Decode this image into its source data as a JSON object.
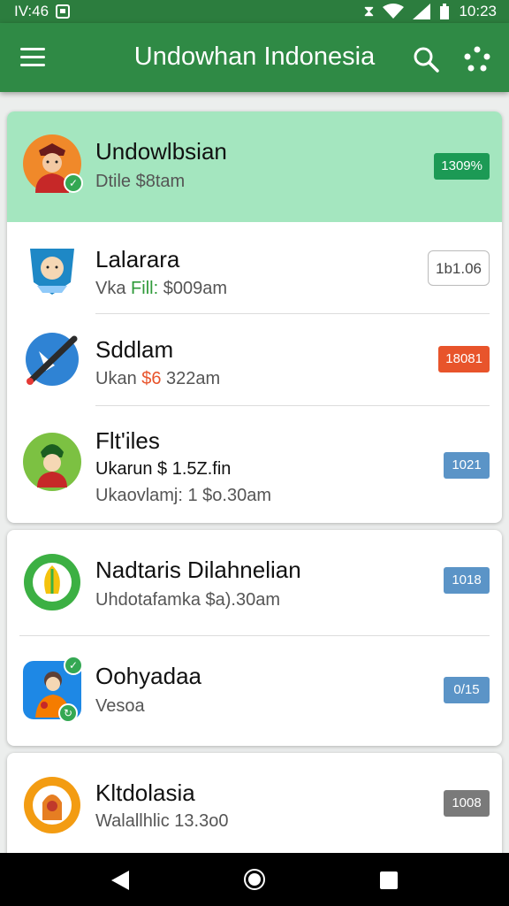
{
  "status_bar": {
    "left_time": "IV:46",
    "right_time": "10:23"
  },
  "app_bar": {
    "title": "Undowhan Indonesia"
  },
  "items": [
    {
      "name": "Undowlbsian",
      "sub": "Dtile $8tam",
      "badge": "1309%",
      "badge_color": "#1c9a55"
    },
    {
      "name": "Lalarara",
      "sub_prefix": "Vka ",
      "sub_highlight": "Fill:",
      "sub_suffix": " $009am",
      "badge": "1b1.06",
      "badge_prefix": "#"
    },
    {
      "name": "Sddlam",
      "sub_prefix": "Ukan ",
      "sub_highlight": "$6",
      "sub_suffix": " 322am",
      "badge": "18081",
      "badge_color": "#e8542b"
    },
    {
      "name": "Flt'iles",
      "sub": "Ukarun $ 1.5Z.fin",
      "sub2": "Ukaovlamj: 1 $o.30am",
      "badge": "1021",
      "badge_color": "#5b94c7"
    },
    {
      "name": "Nadtaris Dilahnelian",
      "sub": "Uhdotafamka $a).30am",
      "badge": "1018",
      "badge_color": "#5b94c7"
    },
    {
      "name": "Oohyadaa",
      "sub": "Vesoa",
      "badge": "0/15",
      "badge_color": "#5b94c7"
    },
    {
      "name": "Kltdolasia",
      "sub": "Walallhlic 13.3o0",
      "badge": "1008",
      "badge_color": "#7a7a7a"
    }
  ]
}
